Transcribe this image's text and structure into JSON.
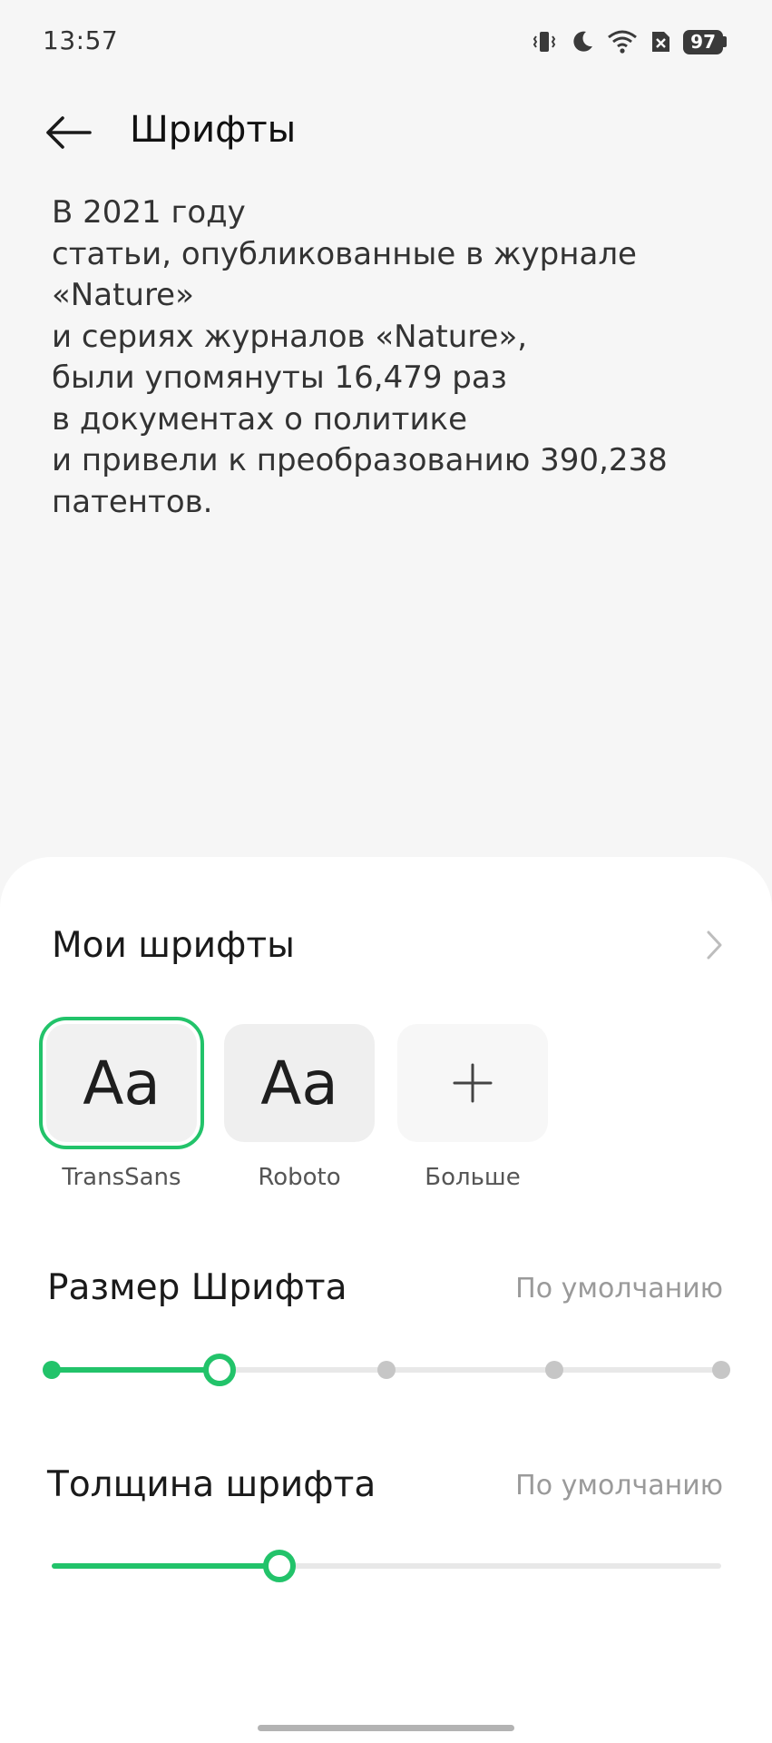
{
  "status_bar": {
    "time": "13:57",
    "battery_level": "97",
    "icons": [
      "vibrate-icon",
      "moon-icon",
      "wifi-icon",
      "no-sim-icon",
      "battery-icon"
    ]
  },
  "app_bar": {
    "title": "Шрифты",
    "back_icon": "arrow-left-icon"
  },
  "preview": {
    "text": "В 2021 году\nстатьи, опубликованные в журнале\n«Nature»\nи сериях журналов «Nature»,\nбыли упомянуты 16,479 раз\nв документах о политике\nи привели к преобразованию 390,238\nпатентов."
  },
  "my_fonts": {
    "title": "Мои шрифты",
    "chevron_icon": "chevron-right-icon",
    "tiles": [
      {
        "sample": "Aa",
        "label": "TransSans",
        "selected": true
      },
      {
        "sample": "Aa",
        "label": "Roboto",
        "selected": false
      },
      {
        "sample": "+",
        "label": "Больше",
        "selected": false
      }
    ]
  },
  "font_size": {
    "title": "Размер Шрифта",
    "value": "По умолчанию",
    "steps": 5,
    "current_step": 2
  },
  "font_weight": {
    "title": "Толщина шрифта",
    "value": "По умолчанию",
    "level_percent": 34
  },
  "colors": {
    "accent": "#22c36a",
    "background": "#f6f6f6",
    "sheet": "#ffffff"
  }
}
